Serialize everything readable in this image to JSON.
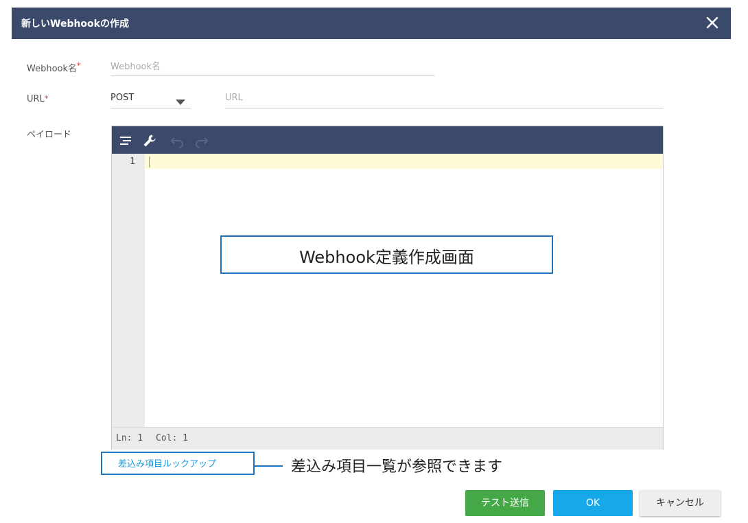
{
  "dialog": {
    "title": "新しいWebhookの作成"
  },
  "form": {
    "name": {
      "label": "Webhook名",
      "required_mark": "*",
      "placeholder": "Webhook名"
    },
    "url": {
      "label": "URL",
      "required_mark": "*",
      "method_value": "POST",
      "placeholder": "URL"
    },
    "payload": {
      "label": "ペイロード"
    }
  },
  "editor": {
    "toolbar_icons": [
      "format-icon",
      "wrench-icon",
      "undo-icon",
      "redo-icon"
    ],
    "line_numbers": [
      "1"
    ],
    "status": {
      "ln": "Ln: 1",
      "col": "Col: 1"
    }
  },
  "annotations": {
    "editor_caption": "Webhook定義作成画面",
    "lookup_callout": "差込み項目一覧が参照できます"
  },
  "lookup_link": "差込み項目ルックアップ",
  "buttons": {
    "test_send": "テスト送信",
    "ok": "OK",
    "cancel": "キャンセル"
  },
  "colors": {
    "header": "#3b4a6b",
    "test_button": "#45a847",
    "ok_button": "#16a8e8",
    "link": "#1a9ad6",
    "annotation_border": "#1e73be"
  }
}
